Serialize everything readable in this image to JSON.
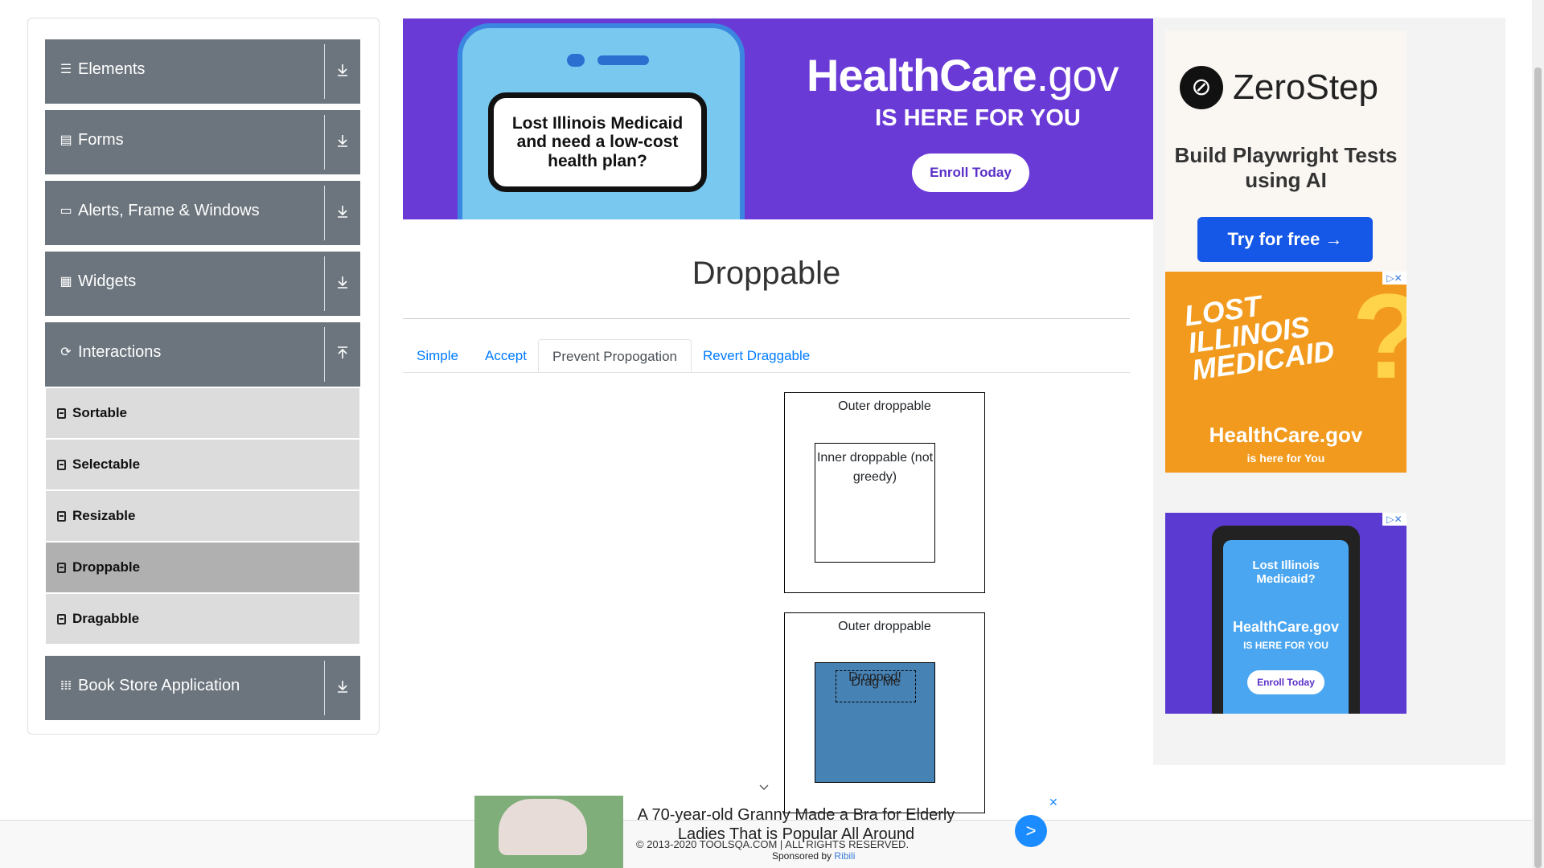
{
  "sidebar": {
    "groups": [
      {
        "label": "Elements",
        "icon": "hamburger-icon"
      },
      {
        "label": "Forms",
        "icon": "document-icon"
      },
      {
        "label": "Alerts, Frame & Windows",
        "icon": "window-icon"
      },
      {
        "label": "Widgets",
        "icon": "widgets-grid-icon"
      },
      {
        "label": "Interactions",
        "icon": "interactions-icon",
        "expanded": true
      },
      {
        "label": "Book Store Application",
        "icon": "books-icon"
      }
    ],
    "interaction_items": [
      {
        "label": "Sortable"
      },
      {
        "label": "Selectable"
      },
      {
        "label": "Resizable"
      },
      {
        "label": "Droppable",
        "active": true
      },
      {
        "label": "Dragabble"
      }
    ]
  },
  "top_ad": {
    "bubble_text": "Lost Illinois Medicaid and need a low-cost health plan?",
    "logo_main": "HealthCare",
    "logo_suffix": ".gov",
    "tagline": "IS HERE FOR YOU",
    "button": "Enroll Today",
    "bg_color": "#6a3ad7"
  },
  "page": {
    "title": "Droppable",
    "tabs": [
      {
        "label": "Simple",
        "active": false
      },
      {
        "label": "Accept",
        "active": false
      },
      {
        "label": "Prevent Propogation",
        "active": true
      },
      {
        "label": "Revert Draggable",
        "active": false
      }
    ],
    "box1": {
      "outer_label": "Outer droppable",
      "inner_label": "Inner droppable (not greedy)"
    },
    "box2": {
      "outer_label": "Outer droppable",
      "inner_label": "Dropped!",
      "drag_label": "Drag Me",
      "inner_color": "#4682b4"
    }
  },
  "right_ads": {
    "zerostep": {
      "name": "ZeroStep",
      "tagline": "Build Playwright Tests using AI",
      "button": "Try for free →"
    },
    "ad2": {
      "lines": [
        "LOST",
        "ILLINOIS",
        "MEDICAID"
      ],
      "logo": "HealthCare.gov",
      "sub": "is here for You"
    },
    "ad3": {
      "question": "Lost Illinois Medicaid?",
      "logo": "HealthCare.gov",
      "tagline": "IS HERE FOR YOU",
      "button": "Enroll Today"
    }
  },
  "footer": {
    "copyright": "© 2013-2020 TOOLSQA.COM | ALL RIGHTS RESERVED."
  },
  "bottom_ad": {
    "headline": "A 70-year-old Granny Made a Bra for Elderly Ladies That is Popular All Around",
    "sponsored_prefix": "Sponsored by",
    "sponsor": "Ribili",
    "go": ">",
    "close": "✕"
  }
}
